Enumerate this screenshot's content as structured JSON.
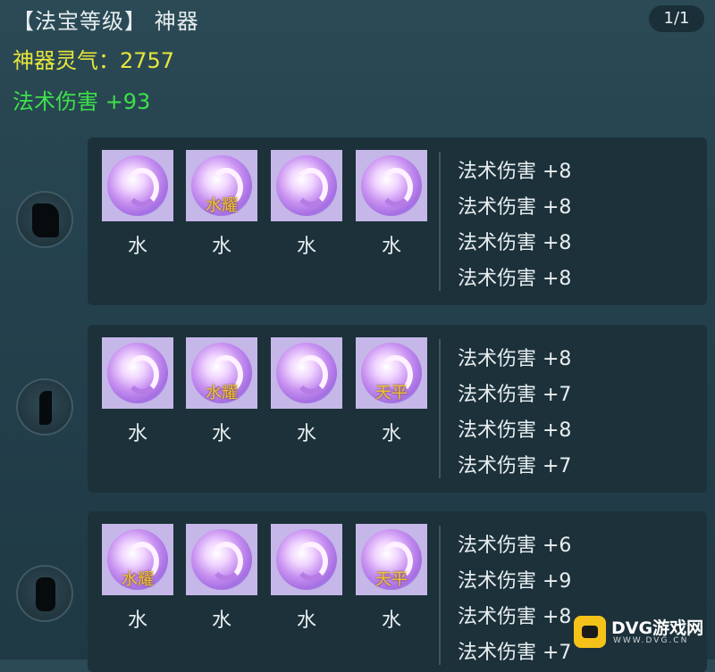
{
  "header": {
    "title": "【法宝等级】 神器",
    "page_indicator": "1/1",
    "aura": "神器灵气：2757",
    "total_bonus": "法术伤害 +93"
  },
  "sections": [
    {
      "slot_icon": "cape-silhouette-icon",
      "gems": [
        {
          "label": "水",
          "tag": ""
        },
        {
          "label": "水",
          "tag": "水耀"
        },
        {
          "label": "水",
          "tag": ""
        },
        {
          "label": "水",
          "tag": ""
        }
      ],
      "stats": [
        "法术伤害 +8",
        "法术伤害 +8",
        "法术伤害 +8",
        "法术伤害 +8"
      ]
    },
    {
      "slot_icon": "blade-silhouette-icon",
      "gems": [
        {
          "label": "水",
          "tag": ""
        },
        {
          "label": "水",
          "tag": "水耀"
        },
        {
          "label": "水",
          "tag": ""
        },
        {
          "label": "水",
          "tag": "天平"
        }
      ],
      "stats": [
        "法术伤害 +8",
        "法术伤害 +7",
        "法术伤害 +8",
        "法术伤害 +7"
      ]
    },
    {
      "slot_icon": "vase-silhouette-icon",
      "gems": [
        {
          "label": "水",
          "tag": "水耀"
        },
        {
          "label": "水",
          "tag": ""
        },
        {
          "label": "水",
          "tag": ""
        },
        {
          "label": "水",
          "tag": "天平"
        }
      ],
      "stats": [
        "法术伤害 +6",
        "法术伤害 +9",
        "法术伤害 +8",
        "法术伤害 +7"
      ]
    }
  ],
  "watermark": {
    "brand": "DVG游戏网",
    "url": "WWW.DVG.CN",
    "icon": "robot-logo-icon"
  }
}
